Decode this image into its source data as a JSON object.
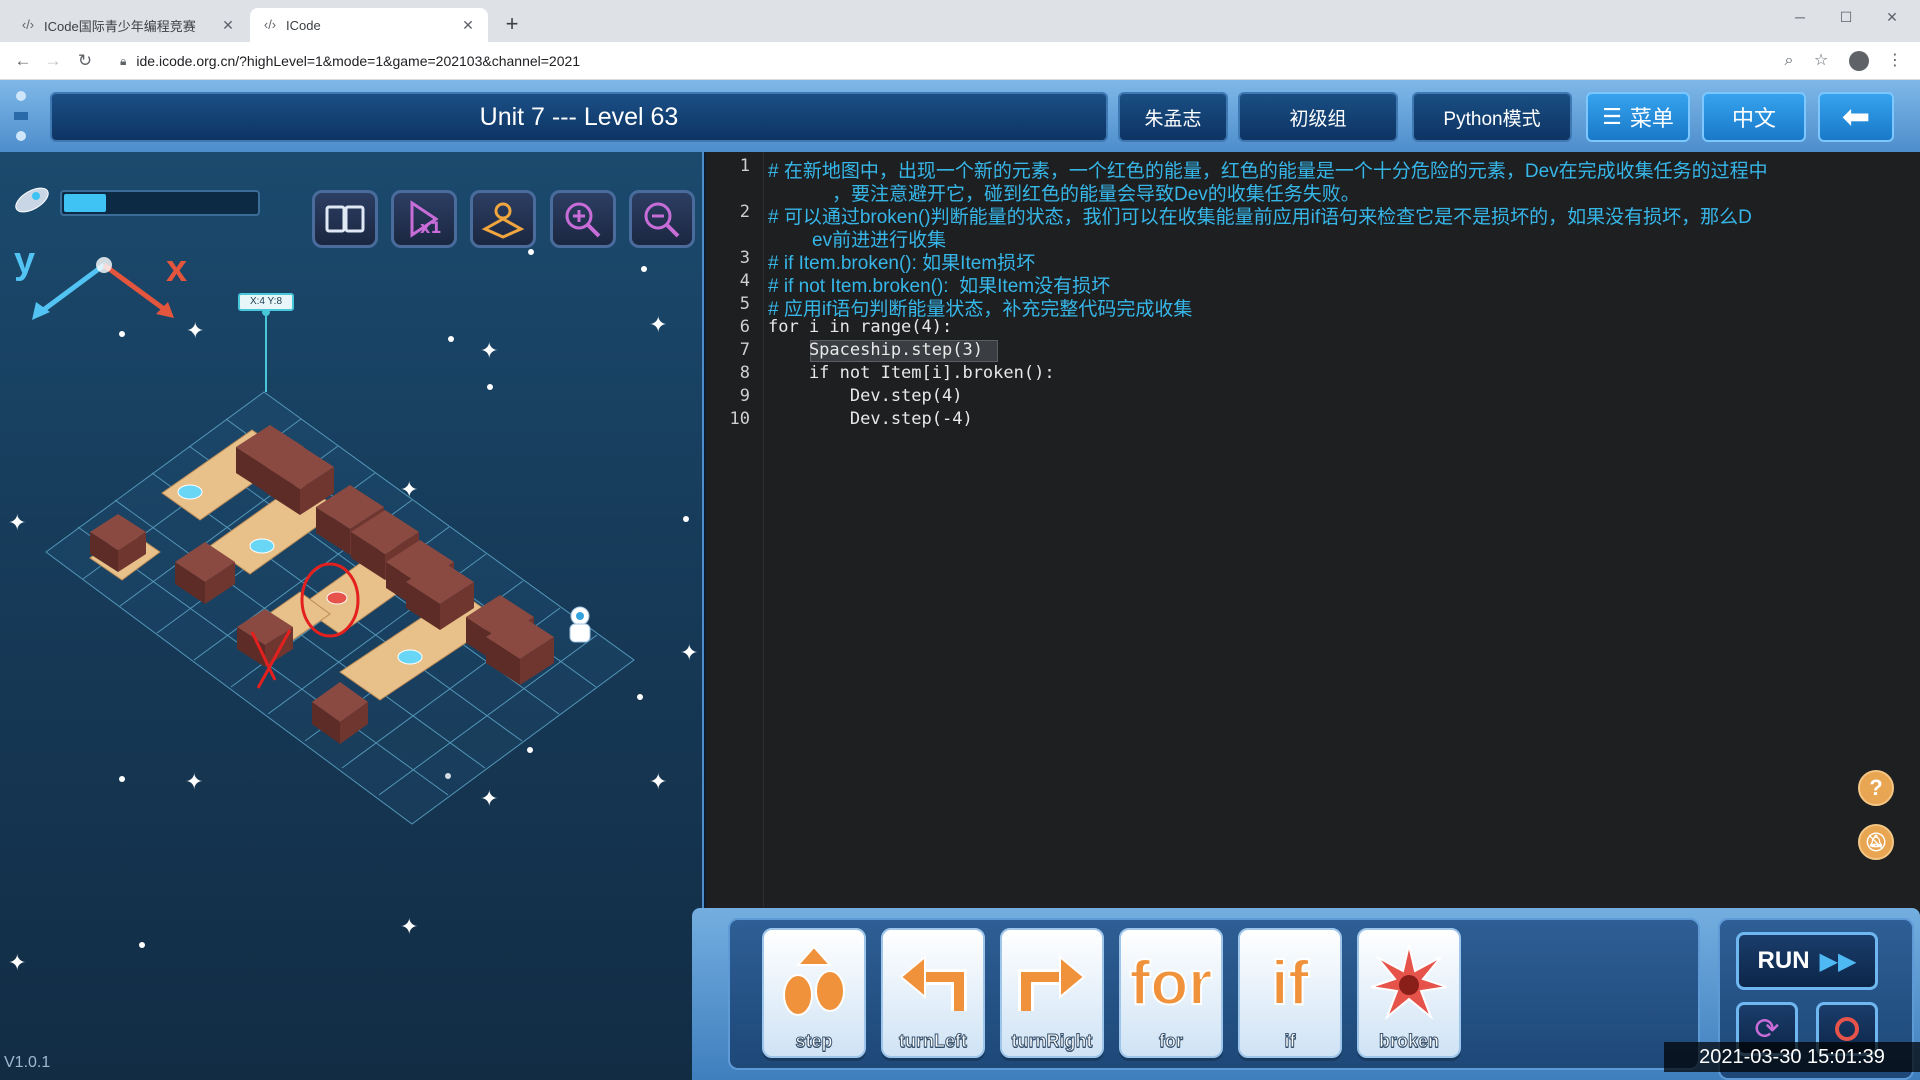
{
  "browser": {
    "tabs": [
      {
        "label": "ICode国际青少年编程竞赛",
        "active": false
      },
      {
        "label": "ICode",
        "active": true
      }
    ],
    "url": "ide.icode.org.cn/?highLevel=1&mode=1&game=202103&channel=2021"
  },
  "header": {
    "level_title": "Unit 7 --- Level 63",
    "user_name": "朱孟志",
    "group": "初级组",
    "mode": "Python模式",
    "menu_label": "菜单",
    "language": "中文"
  },
  "game": {
    "progress": 0.22,
    "axis_y": "y",
    "axis_x": "x",
    "coord_tag": "X:4 Y:8",
    "version": "V1.0.1"
  },
  "editor": {
    "lines": [
      {
        "n": "1",
        "text": "# 在新地图中，出现一个新的元素，一个红色的能量，红色的能量是一个十分危险的元素，Dev在完成收集任务的过程中"
      },
      {
        "n": "",
        "text": "，要注意避开它，碰到红色的能量会导致Dev的收集任务失败。"
      },
      {
        "n": "2",
        "text": "# 可以通过broken()判断能量的状态，我们可以在收集能量前应用if语句来检查它是不是损坏的，如果没有损坏，那么D"
      },
      {
        "n": "",
        "text": "ev前进进行收集"
      },
      {
        "n": "3",
        "text": "# if Item.broken(): 如果Item损坏"
      },
      {
        "n": "4",
        "text": "# if not Item.broken():  如果Item没有损坏"
      },
      {
        "n": "5",
        "text": "# 应用if语句判断能量状态，补充完整代码完成收集"
      },
      {
        "n": "6",
        "text": "for i in range(4):"
      },
      {
        "n": "7",
        "text": "    Spaceship.step(3)"
      },
      {
        "n": "8",
        "text": "    if not Item[i].broken():"
      },
      {
        "n": "9",
        "text": "        Dev.step(4)"
      },
      {
        "n": "10",
        "text": "        Dev.step(-4)"
      }
    ]
  },
  "blocks": [
    {
      "label": "step"
    },
    {
      "label": "turnLeft"
    },
    {
      "label": "turnRight"
    },
    {
      "label": "for",
      "icon_text": "for"
    },
    {
      "label": "if",
      "icon_text": "if"
    },
    {
      "label": "broken"
    }
  ],
  "controls": {
    "run_label": "RUN",
    "timestamp": "2021-03-30  15:01:39"
  },
  "colors": {
    "accent": "#37b6e8",
    "header_dark": "#0d3463",
    "danger": "#e5534b"
  }
}
